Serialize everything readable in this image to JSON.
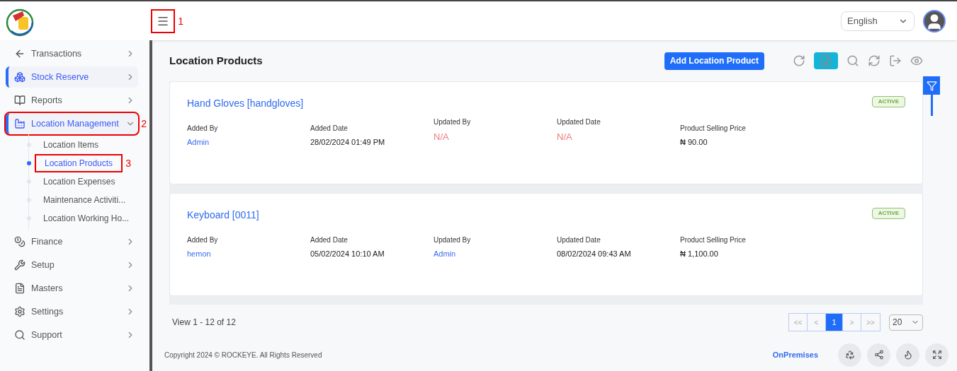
{
  "header": {
    "menu_annotation": "1",
    "language": "English"
  },
  "sidebar": {
    "items": [
      {
        "label": "Transactions",
        "selected": false,
        "expanded": false
      },
      {
        "label": "Stock Reserve",
        "selected": true,
        "expanded": false
      },
      {
        "label": "Reports",
        "selected": false,
        "expanded": false
      },
      {
        "label": "Location Management",
        "selected": true,
        "expanded": true,
        "annotation": "2",
        "children": [
          {
            "label": "Location Items",
            "selected": false
          },
          {
            "label": "Location Products",
            "selected": true,
            "annotation": "3"
          },
          {
            "label": "Location Expenses",
            "selected": false
          },
          {
            "label": "Maintenance Activiti...",
            "selected": false
          },
          {
            "label": "Location Working Ho...",
            "selected": false
          }
        ]
      },
      {
        "label": "Finance",
        "selected": false,
        "expanded": false
      },
      {
        "label": "Setup",
        "selected": false,
        "expanded": false
      },
      {
        "label": "Masters",
        "selected": false,
        "expanded": false
      },
      {
        "label": "Settings",
        "selected": false,
        "expanded": false
      },
      {
        "label": "Support",
        "selected": false,
        "expanded": false
      }
    ]
  },
  "page": {
    "title": "Location Products",
    "add_button": "Add Location Product"
  },
  "cards": [
    {
      "title": "Hand Gloves [handgloves]",
      "status": "ACTIVE",
      "fields": [
        {
          "label": "Added By",
          "value": "Admin",
          "kind": "link"
        },
        {
          "label": "Added Date",
          "value": "28/02/2024 01:49 PM",
          "kind": "text"
        },
        {
          "label": "Updated By",
          "value": "N/A",
          "kind": "missing"
        },
        {
          "label": "Updated Date",
          "value": "N/A",
          "kind": "missing"
        },
        {
          "label": "Product Selling Price",
          "value": "₦ 90.00",
          "kind": "text"
        }
      ]
    },
    {
      "title": "Keyboard [0011]",
      "status": "ACTIVE",
      "fields": [
        {
          "label": "Added By",
          "value": "hemon",
          "kind": "link"
        },
        {
          "label": "Added Date",
          "value": "05/02/2024 10:10 AM",
          "kind": "text"
        },
        {
          "label": "Updated By",
          "value": "Admin",
          "kind": "link"
        },
        {
          "label": "Updated Date",
          "value": "08/02/2024 09:43 AM",
          "kind": "text"
        },
        {
          "label": "Product Selling Price",
          "value": "₦ 1,100.00",
          "kind": "text"
        }
      ]
    }
  ],
  "pagination": {
    "summary": "View 1 - 12 of 12",
    "first": "<<",
    "prev": "<",
    "pages": [
      {
        "label": "1",
        "selected": true
      }
    ],
    "next": ">",
    "last": ">>",
    "page_size": "20"
  },
  "footer": {
    "copyright": "Copyright 2024 © ROCKEYE. All Rights Reserved",
    "mode": "OnPremises"
  }
}
